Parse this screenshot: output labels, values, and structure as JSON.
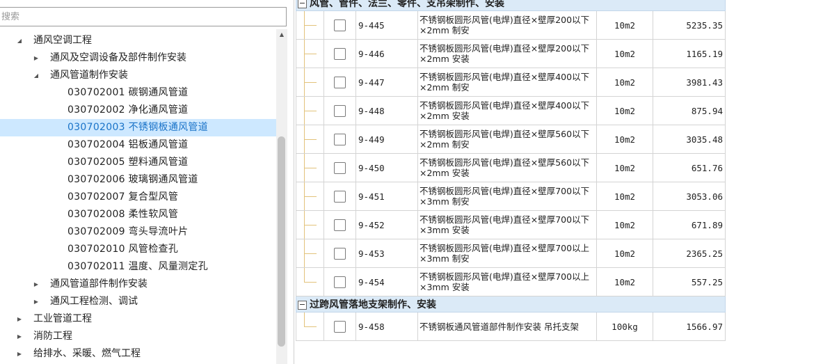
{
  "search": {
    "placeholder": "搜索"
  },
  "tree": [
    {
      "label": "通风空调工程",
      "level": 1,
      "twist": "down"
    },
    {
      "label": "通风及空调设备及部件制作安装",
      "level": 2,
      "twist": "right"
    },
    {
      "label": "通风管道制作安装",
      "level": 2,
      "twist": "down"
    },
    {
      "label": "030702001  碳钢通风管道",
      "level": 3,
      "twist": ""
    },
    {
      "label": "030702002  净化通风管道",
      "level": 3,
      "twist": ""
    },
    {
      "label": "030702003  不锈钢板通风管道",
      "level": 3,
      "twist": "",
      "selected": true
    },
    {
      "label": "030702004  铝板通风管道",
      "level": 3,
      "twist": ""
    },
    {
      "label": "030702005  塑料通风管道",
      "level": 3,
      "twist": ""
    },
    {
      "label": "030702006  玻璃钢通风管道",
      "level": 3,
      "twist": ""
    },
    {
      "label": "030702007  复合型风管",
      "level": 3,
      "twist": ""
    },
    {
      "label": "030702008  柔性软风管",
      "level": 3,
      "twist": ""
    },
    {
      "label": "030702009  弯头导流叶片",
      "level": 3,
      "twist": ""
    },
    {
      "label": "030702010  风管检查孔",
      "level": 3,
      "twist": ""
    },
    {
      "label": "030702011  温度、风量测定孔",
      "level": 3,
      "twist": ""
    },
    {
      "label": "通风管道部件制作安装",
      "level": 2,
      "twist": "right"
    },
    {
      "label": "通风工程检测、调试",
      "level": 2,
      "twist": "right"
    },
    {
      "label": "工业管道工程",
      "level": 1,
      "twist": "right"
    },
    {
      "label": "消防工程",
      "level": 1,
      "twist": "right"
    },
    {
      "label": "给排水、采暖、燃气工程",
      "level": 1,
      "twist": "right"
    }
  ],
  "groups": [
    {
      "title": "风管、管件、法兰、零件、支吊架制作、安装",
      "toggle": "−",
      "rows": [
        {
          "code": "9-445",
          "name": "不锈钢板圆形风管(电焊)直径×壁厚200以下×2mm 制安",
          "unit": "10m2",
          "price": "5235.35"
        },
        {
          "code": "9-446",
          "name": "不锈钢板圆形风管(电焊)直径×壁厚200以下×2mm 安装",
          "unit": "10m2",
          "price": "1165.19"
        },
        {
          "code": "9-447",
          "name": "不锈钢板圆形风管(电焊)直径×壁厚400以下×2mm 制安",
          "unit": "10m2",
          "price": "3981.43"
        },
        {
          "code": "9-448",
          "name": "不锈钢板圆形风管(电焊)直径×壁厚400以下×2mm 安装",
          "unit": "10m2",
          "price": "875.94"
        },
        {
          "code": "9-449",
          "name": "不锈钢板圆形风管(电焊)直径×壁厚560以下×2mm 制安",
          "unit": "10m2",
          "price": "3035.48"
        },
        {
          "code": "9-450",
          "name": "不锈钢板圆形风管(电焊)直径×壁厚560以下×2mm 安装",
          "unit": "10m2",
          "price": "651.76"
        },
        {
          "code": "9-451",
          "name": "不锈钢板圆形风管(电焊)直径×壁厚700以下×3mm 制安",
          "unit": "10m2",
          "price": "3053.06"
        },
        {
          "code": "9-452",
          "name": "不锈钢板圆形风管(电焊)直径×壁厚700以下×3mm 安装",
          "unit": "10m2",
          "price": "671.89"
        },
        {
          "code": "9-453",
          "name": "不锈钢板圆形风管(电焊)直径×壁厚700以上×3mm 制安",
          "unit": "10m2",
          "price": "2365.25"
        },
        {
          "code": "9-454",
          "name": "不锈钢板圆形风管(电焊)直径×壁厚700以上×3mm 安装",
          "unit": "10m2",
          "price": "557.25"
        }
      ]
    },
    {
      "title": "过跨风管落地支架制作、安装",
      "toggle": "−",
      "rows": [
        {
          "code": "9-458",
          "name": "不锈钢板通风管道部件制作安装 吊托支架",
          "unit": "100kg",
          "price": "1566.97"
        }
      ]
    }
  ],
  "colors": {
    "selection": "#cde8ff",
    "selected_text": "#1a73c8",
    "group_header": "#dbeaf7",
    "tree_line": "#e2c27a"
  }
}
